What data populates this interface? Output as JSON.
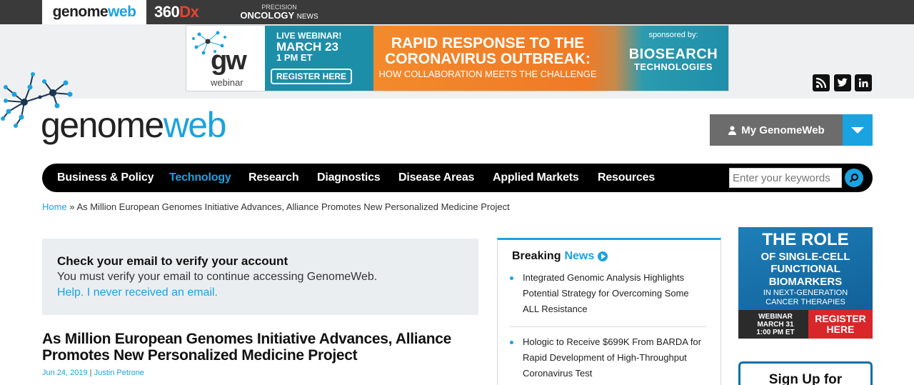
{
  "network": {
    "gw_part1": "genome",
    "gw_part2": "web",
    "dx_part1": "360",
    "dx_part2": "Dx",
    "po_line1": "PRECISION",
    "po_line2": "ONCOLOGY",
    "po_line3": "NEWS"
  },
  "banner": {
    "gw_logo": "gw",
    "gw_sub": "webinar",
    "live": "LIVE WEBINAR!",
    "date": "MARCH 23",
    "time": "1 PM ET",
    "register": "REGISTER HERE",
    "headline1": "RAPID RESPONSE TO THE",
    "headline2": "CORONAVIRUS OUTBREAK:",
    "subhead": "HOW COLLABORATION MEETS THE CHALLENGE",
    "sponsored": "sponsored by:",
    "sponsor1": "BIOSEARCH",
    "sponsor2": "TECHNOLOGIES"
  },
  "social": {
    "rss": "rss-icon",
    "twitter": "twitter-icon",
    "linkedin": "linkedin-icon"
  },
  "logo": {
    "part1": "genome",
    "part2": "web"
  },
  "account": {
    "label": "My GenomeWeb"
  },
  "nav": {
    "items": [
      {
        "label": "Business & Policy"
      },
      {
        "label": "Technology"
      },
      {
        "label": "Research"
      },
      {
        "label": "Diagnostics"
      },
      {
        "label": "Disease Areas"
      },
      {
        "label": "Applied Markets"
      },
      {
        "label": "Resources"
      }
    ],
    "active_index": 1,
    "search_placeholder": "Enter your keywords"
  },
  "breadcrumb": {
    "home": "Home",
    "sep": " » ",
    "current": "As Million European Genomes Initiative Advances, Alliance Promotes New Personalized Medicine Project"
  },
  "verify": {
    "title": "Check your email to verify your account",
    "body": "You must verify your email to continue accessing GenomeWeb.",
    "help": "Help. I never received an email."
  },
  "article": {
    "title": "As Million European Genomes Initiative Advances, Alliance Promotes New Personalized Medicine Project",
    "date": "Jun 24, 2019",
    "sep": " | ",
    "author": "Justin Petrone"
  },
  "breaking": {
    "title1": "Breaking",
    "title2": "News",
    "items": [
      {
        "text": "Integrated Genomic Analysis Highlights Potential Strategy for Overcoming Some ALL Resistance"
      },
      {
        "text": "Hologic to Receive $699K From BARDA for Rapid Development of High-Throughput Coronavirus Test"
      }
    ]
  },
  "side_ad": {
    "line1": "THE ROLE",
    "line2": "OF SINGLE-CELL",
    "line3": "FUNCTIONAL",
    "line4": "BIOMARKERS",
    "line5": "IN NEXT-GENERATION",
    "line6": "CANCER THERAPIES",
    "webinar": "WEBINAR",
    "date": "MARCH 31",
    "time": "1:00 PM ET",
    "register": "REGISTER HERE"
  },
  "signup": {
    "label": "Sign Up for"
  },
  "colors": {
    "accent": "#1aa3e0",
    "nav_bg": "#000000",
    "account_bg": "#6c6c6c",
    "register_red": "#d9262a"
  }
}
